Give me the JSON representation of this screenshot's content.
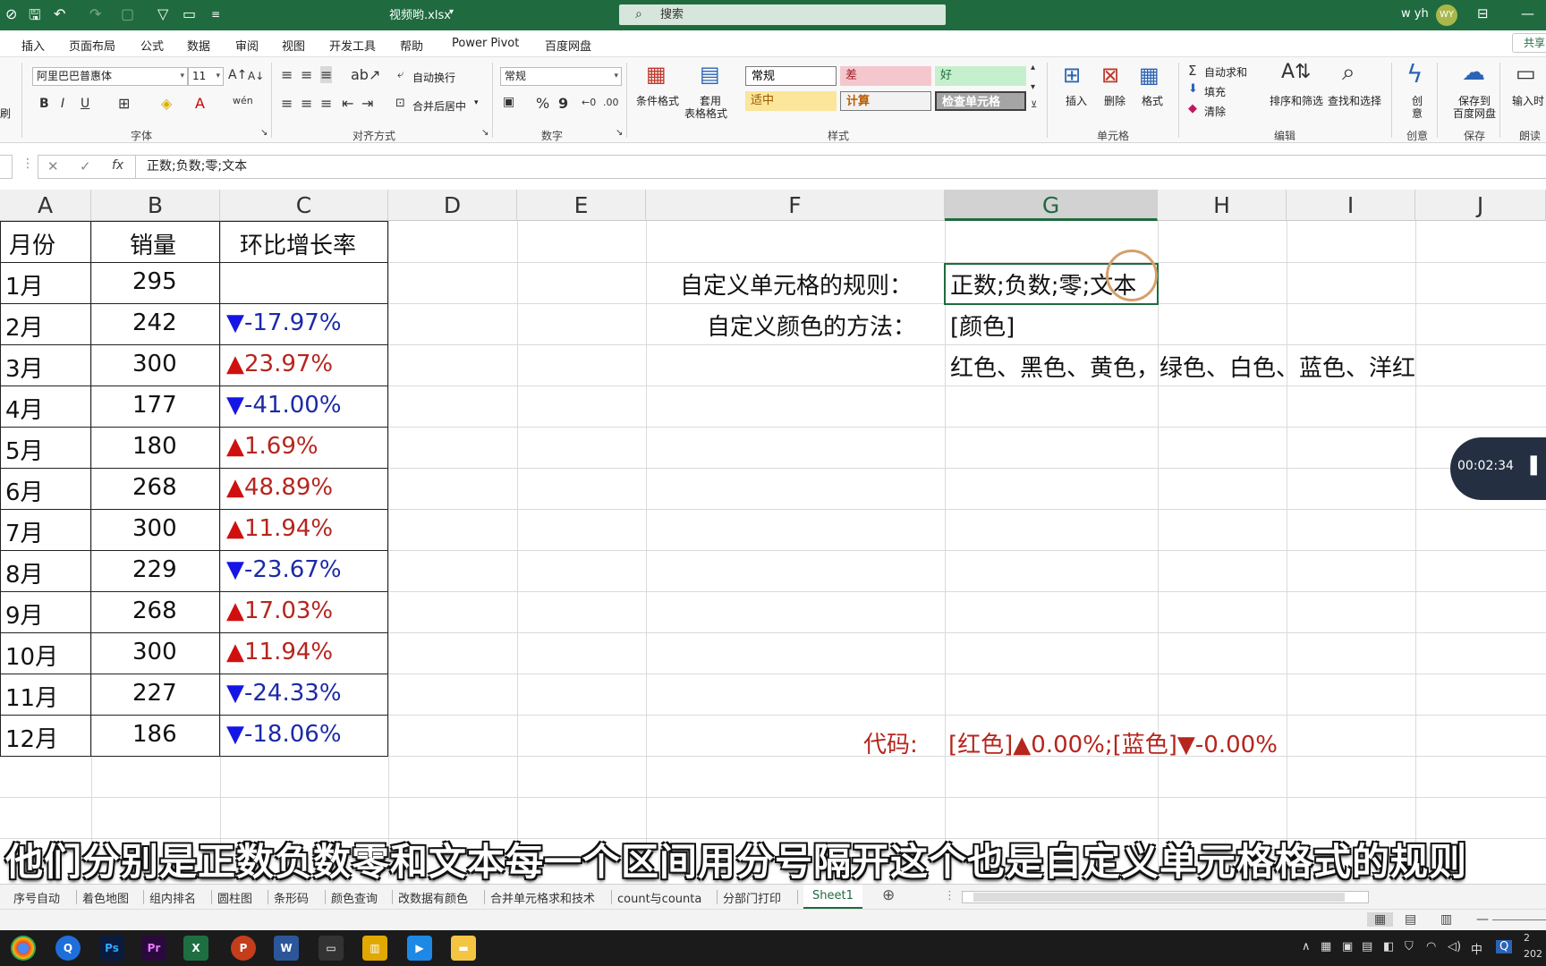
{
  "titlebar": {
    "filename": "视频哟.xlsx",
    "search_placeholder": "搜索",
    "user": "w yh",
    "avatar": "WY",
    "quick_access": [
      "save-icon",
      "undo-icon",
      "redo-icon",
      "filter-icon"
    ]
  },
  "ribbon_tabs": [
    "插入",
    "页面布局",
    "公式",
    "数据",
    "审阅",
    "视图",
    "开发工具",
    "帮助",
    "Power Pivot",
    "百度网盘"
  ],
  "share_label": "共享",
  "ribbon": {
    "font_name": "阿里巴巴普惠体",
    "font_size": "11",
    "font_group": "字体",
    "align_group": "对齐方式",
    "wrap_text": "自动换行",
    "merge_center": "合并后居中",
    "number_format": "常规",
    "number_group": "数字",
    "cond_format": "条件格式",
    "table_format_1": "套用",
    "table_format_2": "表格格式",
    "styles_group": "样式",
    "styles": {
      "normal": "常规",
      "bad": "差",
      "good": "好",
      "neutral": "适中",
      "calc": "计算",
      "check": "检查单元格"
    },
    "insert": "插入",
    "delete": "删除",
    "format": "格式",
    "cells_group": "单元格",
    "autosum": "自动求和",
    "fill": "填充",
    "clear": "清除",
    "sort_filter": "排序和筛选",
    "find_select": "查找和选择",
    "edit_group": "编辑",
    "create_1": "创",
    "create_2": "意",
    "create_group": "创意",
    "save_baidu_1": "保存到",
    "save_baidu_2": "百度网盘",
    "save_group": "保存",
    "read_1": "输入时",
    "read_group": "朗读",
    "left_cut": "刷"
  },
  "formula_bar": {
    "fx": "fx",
    "value": "正数;负数;零;文本"
  },
  "columns": [
    "A",
    "B",
    "C",
    "D",
    "E",
    "F",
    "G",
    "H",
    "I",
    "J"
  ],
  "table": {
    "headers": [
      "月份",
      "销量",
      "环比增长率"
    ],
    "rows": [
      {
        "month": "1月",
        "sales": "295",
        "growth": "",
        "dir": "none"
      },
      {
        "month": "2月",
        "sales": "242",
        "growth": "-17.97%",
        "dir": "down"
      },
      {
        "month": "3月",
        "sales": "300",
        "growth": "23.97%",
        "dir": "up"
      },
      {
        "month": "4月",
        "sales": "177",
        "growth": "-41.00%",
        "dir": "down"
      },
      {
        "month": "5月",
        "sales": "180",
        "growth": "1.69%",
        "dir": "up"
      },
      {
        "month": "6月",
        "sales": "268",
        "growth": "48.89%",
        "dir": "up"
      },
      {
        "month": "7月",
        "sales": "300",
        "growth": "11.94%",
        "dir": "up"
      },
      {
        "month": "8月",
        "sales": "229",
        "growth": "-23.67%",
        "dir": "down"
      },
      {
        "month": "9月",
        "sales": "268",
        "growth": "17.03%",
        "dir": "up"
      },
      {
        "month": "10月",
        "sales": "300",
        "growth": "11.94%",
        "dir": "up"
      },
      {
        "month": "11月",
        "sales": "227",
        "growth": "-24.33%",
        "dir": "down"
      },
      {
        "month": "12月",
        "sales": "186",
        "growth": "-18.06%",
        "dir": "down"
      }
    ],
    "up_glyph": "▲",
    "down_glyph": "▼"
  },
  "notes": {
    "rule_label": "自定义单元格的规则：",
    "rule_value": "正数;负数;零;文本",
    "color_label": "自定义颜色的方法：",
    "color_value": "[颜色]",
    "colors_list": "红色、黑色、黄色，绿色、白色、蓝色、洋红",
    "code_label": "代码:",
    "code_value": "[红色]▲0.00%;[蓝色]▼-0.00%"
  },
  "timer": "00:02:34",
  "subtitle": "他们分别是正数负数零和文本每一个区间用分号隔开这个也是自定义单元格格式的规则",
  "sheet_tabs": [
    "序号自动",
    "着色地图",
    "组内排名",
    "圆柱图",
    "条形码",
    "颜色查询",
    "改数据有颜色",
    "合并单元格求和技术",
    "count与counta",
    "分部门打印",
    "Sheet1"
  ],
  "active_sheet": "Sheet1",
  "colors": {
    "excel_green": "#1f6b3f",
    "up_red": "#d01010",
    "down_blue": "#1515e6",
    "code_red": "#b5261e"
  },
  "taskbar": {
    "apps": [
      "chrome",
      "qq",
      "Ps",
      "Pr",
      "X",
      "P",
      "W",
      "terminal",
      "chart",
      "video",
      "folder"
    ],
    "ime": "中",
    "year_fragment": "202"
  }
}
